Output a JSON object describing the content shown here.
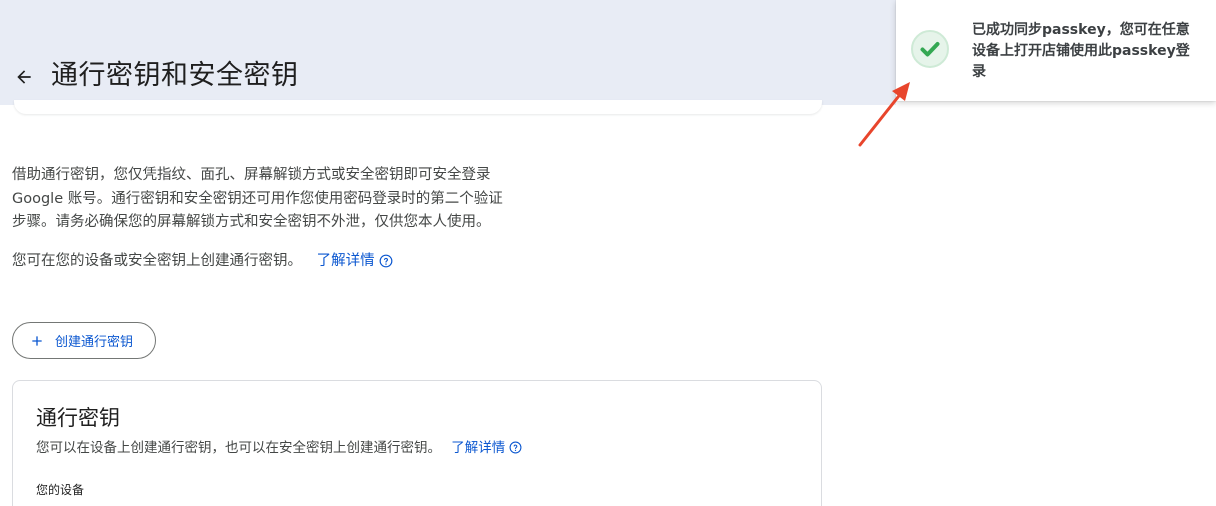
{
  "header": {
    "title": "通行密钥和安全密钥",
    "back_icon": "arrow-left-icon"
  },
  "intro": {
    "line1": "借助通行密钥，您仅凭指纹、面孔、屏幕解锁方式或安全密钥即可安全登录",
    "line2": "Google 账号。通行密钥和安全密钥还可用作您使用密码登录时的第二个验证",
    "line3": "步骤。请务必确保您的屏幕解锁方式和安全密钥不外泄，仅供您本人使用。",
    "create_text": "您可在您的设备或安全密钥上创建通行密钥。",
    "learn_more": "了解详情"
  },
  "create_button": {
    "label": "创建通行密钥",
    "icon": "plus-icon"
  },
  "passkeys_card": {
    "title": "通行密钥",
    "description": "您可以在设备上创建通行密钥，也可以在安全密钥上创建通行密钥。",
    "learn_more": "了解详情",
    "subheading": "您的设备"
  },
  "toast": {
    "message": "已成功同步passkey，您可在任意设备上打开店铺使用此passkey登录",
    "icon": "check-circle-icon"
  },
  "colors": {
    "header_bg": "#e8ecf5",
    "link": "#0b57d0",
    "success": "#34a853",
    "annotation_arrow": "#e8452c"
  }
}
